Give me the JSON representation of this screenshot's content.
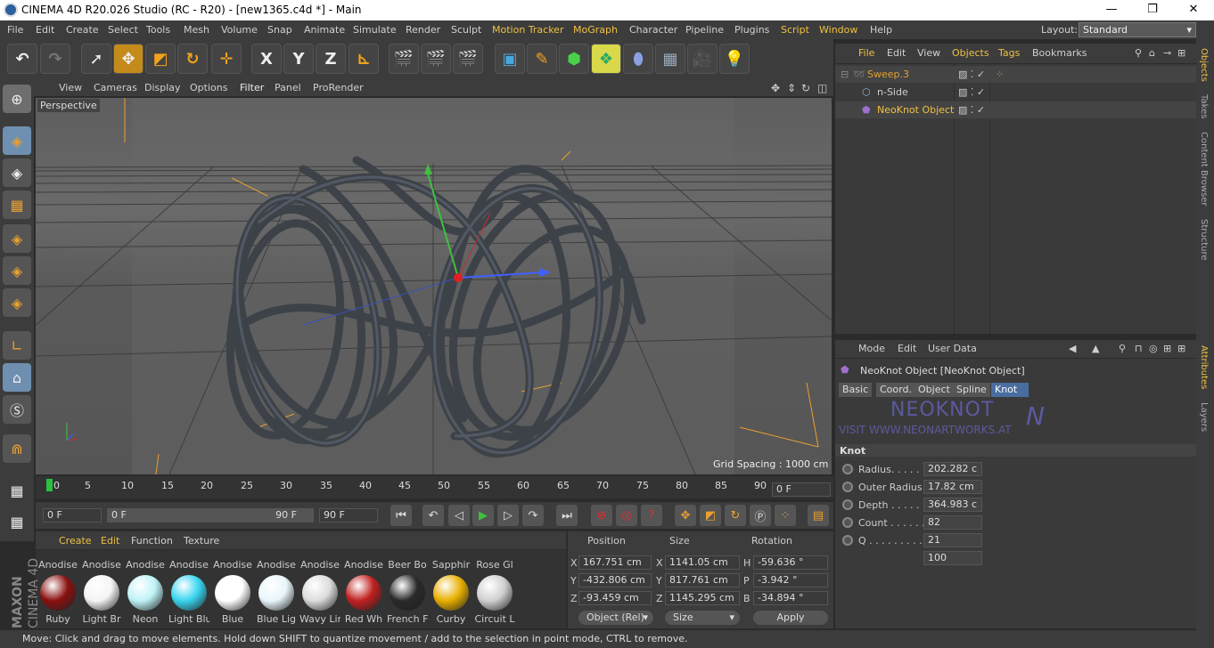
{
  "window": {
    "title": "CINEMA 4D R20.026 Studio (RC - R20) - [new1365.c4d *] - Main",
    "min": "—",
    "max": "❐",
    "close": "✕"
  },
  "menu": [
    "File",
    "Edit",
    "Create",
    "Select",
    "Tools",
    "Mesh",
    "Volume",
    "Snap",
    "Animate",
    "Simulate",
    "Render",
    "Sculpt",
    "Motion Tracker",
    "MoGraph",
    "Character",
    "Pipeline",
    "Plugins",
    "Script",
    "Window",
    "Help"
  ],
  "layout": {
    "label": "Layout:",
    "value": "Standard"
  },
  "toolbar": {
    "x": "X",
    "y": "Y",
    "z": "Z"
  },
  "viewport_menu": [
    "View",
    "Cameras",
    "Display",
    "Options",
    "Filter",
    "Panel",
    "ProRender"
  ],
  "viewport": {
    "label": "Perspective",
    "grid_spacing": "Grid Spacing : 1000 cm"
  },
  "timeline": {
    "ticks": [
      "0",
      "5",
      "10",
      "15",
      "20",
      "25",
      "30",
      "35",
      "40",
      "45",
      "50",
      "55",
      "60",
      "65",
      "70",
      "75",
      "80",
      "85",
      "90"
    ],
    "current": "0 F"
  },
  "transport": {
    "start": "0 F",
    "range_start": "0 F",
    "range_end": "90 F",
    "end": "90 F"
  },
  "materials_menu": [
    "Create",
    "Edit",
    "Function",
    "Texture"
  ],
  "materials_top": [
    "Anodise",
    "Anodise",
    "Anodise",
    "Anodise",
    "Anodise",
    "Anodise",
    "Anodise",
    "Anodise",
    "Beer Bo",
    "Sapphir",
    "Rose Gl"
  ],
  "materials": [
    {
      "name": "Ruby",
      "color": "#8a1010"
    },
    {
      "name": "Light Br",
      "color": "#f4f4f4"
    },
    {
      "name": "Neon",
      "color": "#bff3f7"
    },
    {
      "name": "Light Blu",
      "color": "#38d5f0"
    },
    {
      "name": "Blue",
      "color": "#ffffff"
    },
    {
      "name": "Blue Lig",
      "color": "#e8f6fb"
    },
    {
      "name": "Wavy Lin",
      "color": "#dcdcdc"
    },
    {
      "name": "Red Wh",
      "color": "#c02020"
    },
    {
      "name": "French F",
      "color": "#2a2a2a"
    },
    {
      "name": "Curby",
      "color": "#e8b000"
    },
    {
      "name": "Circuit L",
      "color": "#d0d0d0"
    }
  ],
  "coords": {
    "headers": {
      "position": "Position",
      "size": "Size",
      "rotation": "Rotation"
    },
    "rows": [
      {
        "axis": "X",
        "pos": "167.751 cm",
        "saxis": "X",
        "size": "1141.05 cm",
        "raxis": "H",
        "rot": "-59.636 °"
      },
      {
        "axis": "Y",
        "pos": "-432.806 cm",
        "saxis": "Y",
        "size": "817.761 cm",
        "raxis": "P",
        "rot": "-3.942 °"
      },
      {
        "axis": "Z",
        "pos": "-93.459 cm",
        "saxis": "Z",
        "size": "1145.295 cm",
        "raxis": "B",
        "rot": "-34.894 °"
      }
    ],
    "mode": "Object (Rel)",
    "size_mode": "Size",
    "apply": "Apply"
  },
  "status": "Move: Click and drag to move elements. Hold down SHIFT to quantize movement / add to the selection in point mode, CTRL to remove.",
  "objects_menu": [
    "File",
    "Edit",
    "View",
    "Objects",
    "Tags",
    "Bookmarks"
  ],
  "objects": [
    {
      "name": "Sweep.3",
      "color": "#e0a030"
    },
    {
      "name": "n-Side",
      "color": "#d0d0d0"
    },
    {
      "name": "NeoKnot Object",
      "color": "#f0c040"
    }
  ],
  "side_tabs": [
    "Objects",
    "Takes",
    "Content Browser",
    "Structure",
    "Attributes",
    "Layers"
  ],
  "attr_menu": [
    "Mode",
    "Edit",
    "User Data"
  ],
  "attr": {
    "title": "NeoKnot Object [NeoKnot Object]",
    "tabs": [
      "Basic",
      "Coord.",
      "Object",
      "Spline",
      "Knot"
    ],
    "logo": "NEOKNOT",
    "logo_sub": "VISIT WWW.NEONARTWORKS.AT",
    "section": "Knot",
    "params": [
      {
        "label": "Radius. . . . . .",
        "value": "202.282 c"
      },
      {
        "label": "Outer Radius",
        "value": "17.82 cm"
      },
      {
        "label": "Depth . . . . . .",
        "value": "364.983 c"
      },
      {
        "label": "Count . . . . . .",
        "value": "82"
      },
      {
        "label": "Q . . . . . . . . . .",
        "value": "21"
      },
      {
        "label": "",
        "value": "100"
      }
    ]
  }
}
